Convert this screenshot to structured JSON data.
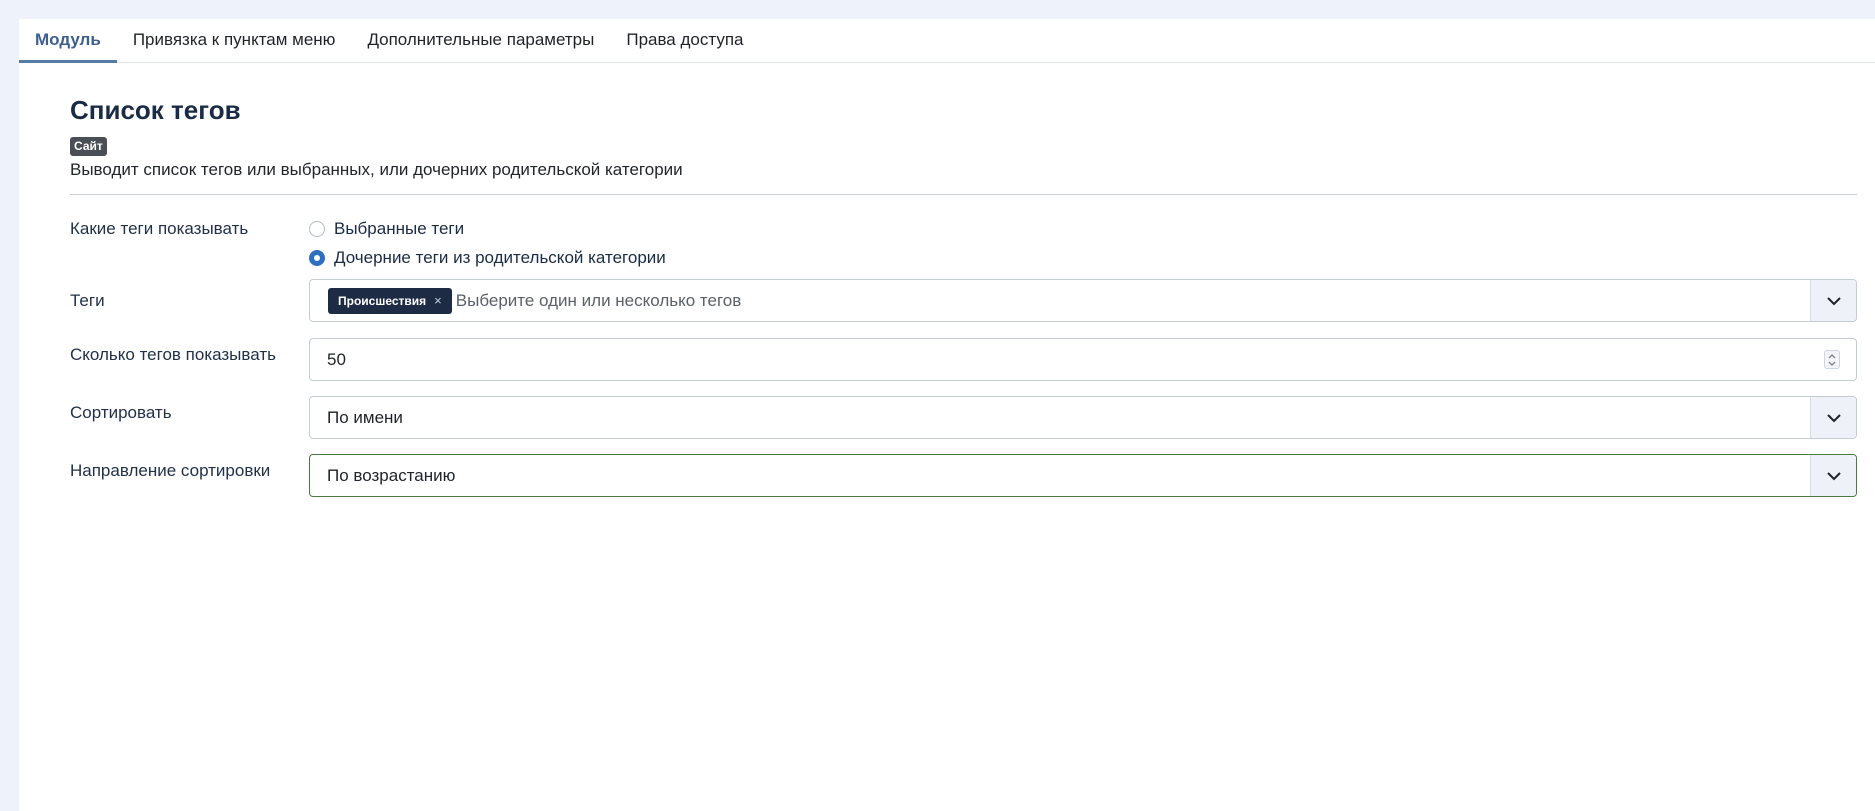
{
  "tabs": [
    {
      "label": "Модуль",
      "active": true
    },
    {
      "label": "Привязка к пунктам меню",
      "active": false
    },
    {
      "label": "Дополнительные параметры",
      "active": false
    },
    {
      "label": "Права доступа",
      "active": false
    }
  ],
  "module": {
    "title": "Список тегов",
    "badge": "Сайт",
    "description": "Выводит список тегов или выбранных, или дочерних родительской категории"
  },
  "fields": {
    "mode": {
      "label": "Какие теги показывать",
      "options": [
        {
          "label": "Выбранные теги",
          "checked": false
        },
        {
          "label": "Дочерние теги из родительской категории",
          "checked": true
        }
      ]
    },
    "tags": {
      "label": "Теги",
      "chip": "Происшествия",
      "chip_remove": "×",
      "placeholder": "Выберите один или несколько тегов"
    },
    "count": {
      "label": "Сколько тегов показывать",
      "value": "50"
    },
    "order": {
      "label": "Сортировать",
      "value": "По имени"
    },
    "direction": {
      "label": "Направление сортировки",
      "value": "По возрастанию"
    }
  },
  "colors": {
    "accent": "#2f6fc2",
    "chip_bg": "#1d2b45",
    "active_tab": "#3c5f8f",
    "focus_border": "#4a7a3f"
  }
}
